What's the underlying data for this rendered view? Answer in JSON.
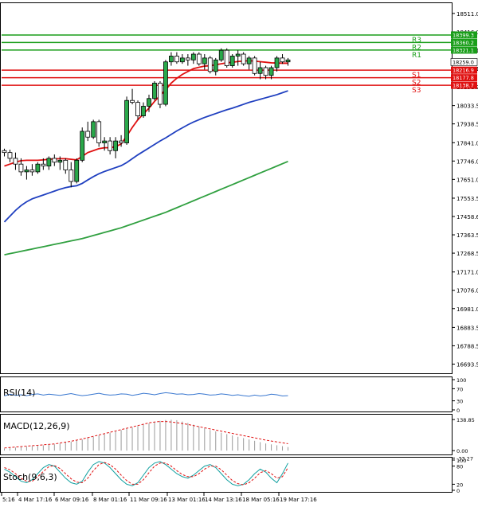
{
  "chart_data": [
    {
      "type": "candlestick",
      "ylim": [
        16650,
        18560
      ],
      "y_ticks": [
        "18511.0",
        "18416.0",
        "18321.1",
        "18226.1",
        "18131.2",
        "18033.5",
        "17938.5",
        "17841.0",
        "17746.0",
        "17651.0",
        "17553.5",
        "17458.6",
        "17363.5",
        "17268.5",
        "17171.0",
        "17076.0",
        "16981.0",
        "16883.5",
        "16788.5",
        "16693.5"
      ],
      "x_ticks": [
        "5:16",
        "4 Mar 17:16",
        "6 Mar 09:16",
        "8 Mar 01:16",
        "11 Mar 09:16",
        "13 Mar 01:16",
        "14 Mar 13:16",
        "18 Mar 05:16",
        "19 Mar 17:16"
      ],
      "levels": [
        {
          "name": "R3",
          "value": 18399.3,
          "label": "18399.3",
          "color": "#1a9e1a"
        },
        {
          "name": "R2",
          "value": 18360.2,
          "label": "18360.2",
          "color": "#1a9e1a"
        },
        {
          "name": "R1",
          "value": 18321.1,
          "label": "18321.1",
          "color": "#1a9e1a"
        },
        {
          "name": "S1",
          "value": 18216.9,
          "label": "18216.9",
          "color": "#e01010"
        },
        {
          "name": "S2",
          "value": 18177.8,
          "label": "18177.8",
          "color": "#e01010"
        },
        {
          "name": "S3",
          "value": 18138.7,
          "label": "18138.7",
          "color": "#e01010"
        }
      ],
      "last_price": "18259.0",
      "candles": [
        [
          17800,
          17810,
          17770,
          17790
        ],
        [
          17790,
          17805,
          17740,
          17760
        ],
        [
          17760,
          17790,
          17700,
          17730
        ],
        [
          17730,
          17760,
          17670,
          17690
        ],
        [
          17690,
          17720,
          17650,
          17700
        ],
        [
          17700,
          17730,
          17670,
          17690
        ],
        [
          17690,
          17740,
          17680,
          17730
        ],
        [
          17730,
          17760,
          17700,
          17720
        ],
        [
          17720,
          17770,
          17700,
          17760
        ],
        [
          17760,
          17780,
          17720,
          17740
        ],
        [
          17740,
          17770,
          17700,
          17750
        ],
        [
          17750,
          17760,
          17680,
          17700
        ],
        [
          17700,
          17740,
          17610,
          17640
        ],
        [
          17640,
          17760,
          17630,
          17750
        ],
        [
          17750,
          17920,
          17740,
          17900
        ],
        [
          17900,
          17950,
          17850,
          17870
        ],
        [
          17870,
          17960,
          17860,
          17950
        ],
        [
          17950,
          17960,
          17820,
          17840
        ],
        [
          17840,
          17870,
          17800,
          17850
        ],
        [
          17850,
          17870,
          17780,
          17800
        ],
        [
          17800,
          17870,
          17760,
          17850
        ],
        [
          17850,
          17880,
          17820,
          17840
        ],
        [
          17840,
          18080,
          17830,
          18060
        ],
        [
          18060,
          18120,
          18040,
          18050
        ],
        [
          18050,
          18060,
          17960,
          17980
        ],
        [
          17980,
          18050,
          17970,
          18030
        ],
        [
          18030,
          18090,
          18000,
          18070
        ],
        [
          18070,
          18160,
          18060,
          18150
        ],
        [
          18150,
          18160,
          18020,
          18040
        ],
        [
          18040,
          18270,
          18030,
          18260
        ],
        [
          18260,
          18310,
          18240,
          18290
        ],
        [
          18290,
          18310,
          18250,
          18260
        ],
        [
          18260,
          18300,
          18250,
          18280
        ],
        [
          18280,
          18300,
          18240,
          18270
        ],
        [
          18270,
          18310,
          18250,
          18300
        ],
        [
          18300,
          18310,
          18240,
          18250
        ],
        [
          18250,
          18300,
          18220,
          18280
        ],
        [
          18280,
          18290,
          18200,
          18210
        ],
        [
          18210,
          18280,
          18190,
          18270
        ],
        [
          18270,
          18330,
          18260,
          18320
        ],
        [
          18320,
          18330,
          18230,
          18240
        ],
        [
          18240,
          18300,
          18230,
          18290
        ],
        [
          18290,
          18320,
          18240,
          18300
        ],
        [
          18300,
          18310,
          18240,
          18250
        ],
        [
          18250,
          18290,
          18220,
          18280
        ],
        [
          18280,
          18290,
          18190,
          18200
        ],
        [
          18200,
          18260,
          18170,
          18230
        ],
        [
          18230,
          18240,
          18170,
          18190
        ],
        [
          18190,
          18240,
          18170,
          18230
        ],
        [
          18230,
          18290,
          18210,
          18280
        ],
        [
          18280,
          18300,
          18250,
          18260
        ],
        [
          18260,
          18280,
          18240,
          18270
        ]
      ],
      "series": [
        {
          "color": "#e01010",
          "values": [
            17720,
            17730,
            17740,
            17748,
            17750,
            17750,
            17750,
            17752,
            17755,
            17757,
            17758,
            17758,
            17755,
            17752,
            17770,
            17790,
            17800,
            17810,
            17815,
            17815,
            17820,
            17835,
            17875,
            17920,
            17960,
            17990,
            18020,
            18055,
            18085,
            18115,
            18150,
            18175,
            18195,
            18210,
            18225,
            18232,
            18238,
            18240,
            18245,
            18250,
            18255,
            18258,
            18262,
            18264,
            18266,
            18264,
            18261,
            18258,
            18255,
            18254,
            18253,
            18253
          ]
        },
        {
          "color": "#2040c0",
          "values": [
            17430,
            17460,
            17490,
            17515,
            17535,
            17550,
            17560,
            17570,
            17580,
            17590,
            17600,
            17608,
            17614,
            17618,
            17630,
            17648,
            17665,
            17680,
            17692,
            17702,
            17712,
            17722,
            17738,
            17758,
            17778,
            17796,
            17814,
            17832,
            17850,
            17866,
            17884,
            17902,
            17918,
            17934,
            17948,
            17960,
            17972,
            17982,
            17992,
            18002,
            18012,
            18020,
            18030,
            18040,
            18050,
            18058,
            18066,
            18074,
            18082,
            18090,
            18100,
            18110
          ]
        },
        {
          "color": "#30a040",
          "values": [
            17260,
            17266,
            17272,
            17278,
            17284,
            17290,
            17296,
            17302,
            17308,
            17314,
            17320,
            17326,
            17332,
            17338,
            17344,
            17352,
            17360,
            17368,
            17376,
            17384,
            17392,
            17400,
            17410,
            17420,
            17430,
            17440,
            17450,
            17460,
            17470,
            17480,
            17492,
            17504,
            17516,
            17528,
            17540,
            17552,
            17564,
            17576,
            17588,
            17600,
            17612,
            17624,
            17636,
            17648,
            17660,
            17672,
            17684,
            17696,
            17708,
            17720,
            17732,
            17744
          ]
        }
      ]
    },
    {
      "type": "line",
      "label": "RSI(14)",
      "ylim": [
        0,
        100
      ],
      "y_ticks": [
        "100",
        "70",
        "30",
        "0"
      ],
      "tick_values": [
        100,
        70,
        30,
        0
      ],
      "values": [
        46,
        52,
        48,
        50,
        47,
        51,
        53,
        49,
        52,
        50,
        48,
        51,
        54,
        50,
        47,
        49,
        52,
        55,
        51,
        49,
        50,
        53,
        52,
        48,
        51,
        55,
        53,
        50,
        54,
        57,
        55,
        52,
        53,
        50,
        51,
        54,
        52,
        49,
        50,
        53,
        51,
        48,
        50,
        47,
        45,
        49,
        46,
        48,
        52,
        50,
        46,
        47
      ]
    },
    {
      "type": "histogram",
      "label": "MACD(12,26,9)",
      "ylim": [
        -10,
        150
      ],
      "y_ticks": [
        "138.85",
        "0.00",
        "-33.27"
      ],
      "tick_values": [
        138.85,
        0,
        -33.27
      ],
      "values": [
        10,
        12,
        14,
        16,
        18,
        20,
        22,
        24,
        26,
        28,
        32,
        36,
        40,
        45,
        50,
        56,
        62,
        68,
        74,
        80,
        86,
        92,
        98,
        104,
        110,
        116,
        122,
        128,
        133,
        137,
        138,
        136,
        130,
        124,
        116,
        108,
        100,
        92,
        86,
        80,
        74,
        68,
        62,
        56,
        50,
        44,
        38,
        32,
        28,
        24,
        20,
        16
      ],
      "signal": [
        12,
        14,
        16,
        18,
        20,
        22,
        24,
        26,
        28,
        30,
        34,
        38,
        42,
        47,
        52,
        58,
        64,
        70,
        76,
        82,
        88,
        94,
        100,
        106,
        112,
        118,
        124,
        128,
        130,
        130,
        128,
        125,
        121,
        117,
        112,
        107,
        102,
        97,
        92,
        87,
        82,
        77,
        72,
        67,
        62,
        57,
        52,
        47,
        43,
        39,
        35,
        31
      ]
    },
    {
      "type": "line",
      "label": "Stoch(9,6,3)",
      "ylim": [
        0,
        100
      ],
      "y_ticks": [
        "100",
        "80",
        "20",
        "0"
      ],
      "tick_values": [
        100,
        80,
        20,
        0
      ],
      "k": [
        70,
        60,
        45,
        30,
        25,
        35,
        55,
        75,
        85,
        80,
        60,
        40,
        25,
        20,
        30,
        60,
        85,
        95,
        90,
        75,
        55,
        35,
        20,
        15,
        25,
        50,
        75,
        90,
        95,
        85,
        70,
        55,
        45,
        40,
        50,
        65,
        80,
        85,
        75,
        55,
        35,
        20,
        15,
        20,
        35,
        55,
        70,
        60,
        40,
        25,
        55,
        90
      ],
      "d": [
        75,
        68,
        55,
        40,
        30,
        30,
        45,
        62,
        78,
        82,
        72,
        55,
        38,
        27,
        25,
        40,
        65,
        85,
        92,
        85,
        70,
        50,
        32,
        20,
        20,
        35,
        58,
        80,
        90,
        90,
        80,
        65,
        52,
        45,
        45,
        55,
        70,
        80,
        80,
        68,
        50,
        32,
        22,
        18,
        25,
        40,
        58,
        65,
        55,
        40,
        45,
        75
      ]
    }
  ]
}
